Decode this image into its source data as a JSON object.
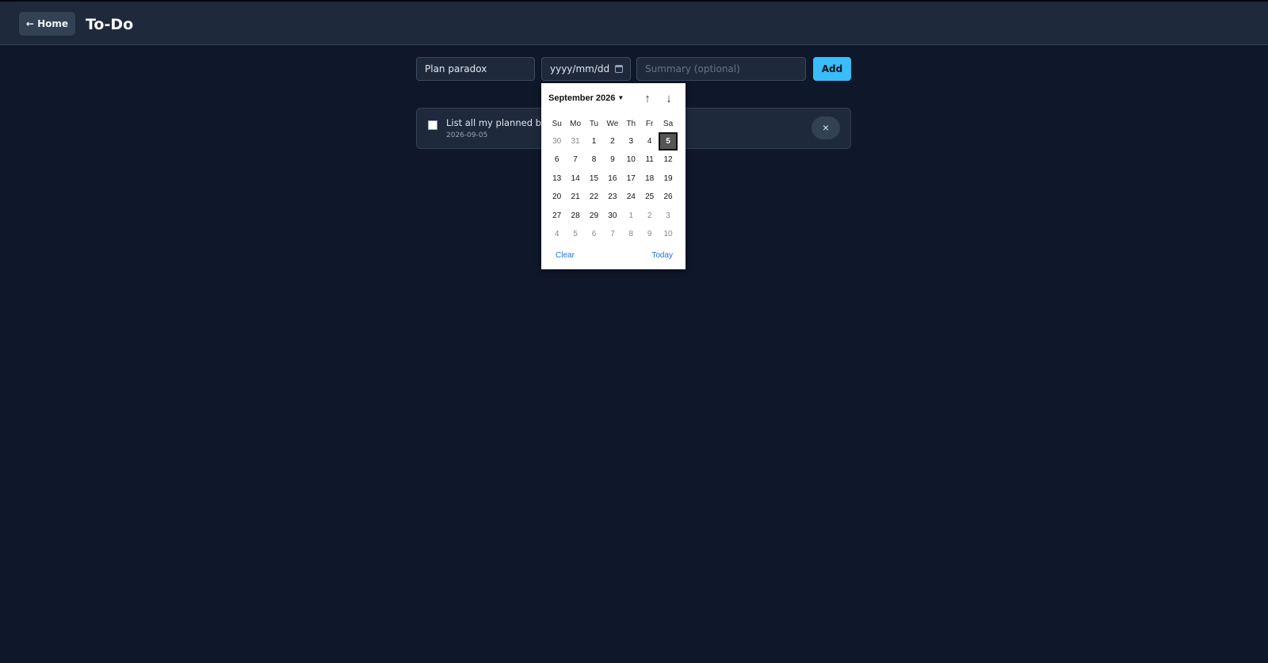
{
  "header": {
    "home_label": "← Home",
    "title": "To-Do"
  },
  "form": {
    "title_value": "Plan paradox",
    "date_placeholder": "yyyy/mm/dd",
    "summary_placeholder": "Summary (optional)",
    "add_label": "Add"
  },
  "todos": [
    {
      "title": "List all my planned books",
      "date": "2026-09-05",
      "delete_label": "×"
    }
  ],
  "calendar": {
    "month_label": "September 2026",
    "weekdays": [
      "Su",
      "Mo",
      "Tu",
      "We",
      "Th",
      "Fr",
      "Sa"
    ],
    "weeks": [
      [
        {
          "d": "30",
          "o": true
        },
        {
          "d": "31",
          "o": true
        },
        {
          "d": "1"
        },
        {
          "d": "2"
        },
        {
          "d": "3"
        },
        {
          "d": "4"
        },
        {
          "d": "5",
          "sel": true
        }
      ],
      [
        {
          "d": "6"
        },
        {
          "d": "7"
        },
        {
          "d": "8"
        },
        {
          "d": "9"
        },
        {
          "d": "10"
        },
        {
          "d": "11"
        },
        {
          "d": "12"
        }
      ],
      [
        {
          "d": "13"
        },
        {
          "d": "14"
        },
        {
          "d": "15"
        },
        {
          "d": "16"
        },
        {
          "d": "17"
        },
        {
          "d": "18"
        },
        {
          "d": "19"
        }
      ],
      [
        {
          "d": "20"
        },
        {
          "d": "21"
        },
        {
          "d": "22"
        },
        {
          "d": "23"
        },
        {
          "d": "24"
        },
        {
          "d": "25"
        },
        {
          "d": "26"
        }
      ],
      [
        {
          "d": "27"
        },
        {
          "d": "28"
        },
        {
          "d": "29"
        },
        {
          "d": "30"
        },
        {
          "d": "1",
          "o": true
        },
        {
          "d": "2",
          "o": true
        },
        {
          "d": "3",
          "o": true
        }
      ],
      [
        {
          "d": "4",
          "o": true
        },
        {
          "d": "5",
          "o": true
        },
        {
          "d": "6",
          "o": true
        },
        {
          "d": "7",
          "o": true
        },
        {
          "d": "8",
          "o": true
        },
        {
          "d": "9",
          "o": true
        },
        {
          "d": "10",
          "o": true
        }
      ]
    ],
    "clear_label": "Clear",
    "today_label": "Today",
    "up_icon": "arrow-up-icon",
    "down_icon": "arrow-down-icon"
  },
  "colors": {
    "background": "#0f172a",
    "header": "#1e293b",
    "accent": "#38bdf8",
    "link": "#1a73e8"
  }
}
